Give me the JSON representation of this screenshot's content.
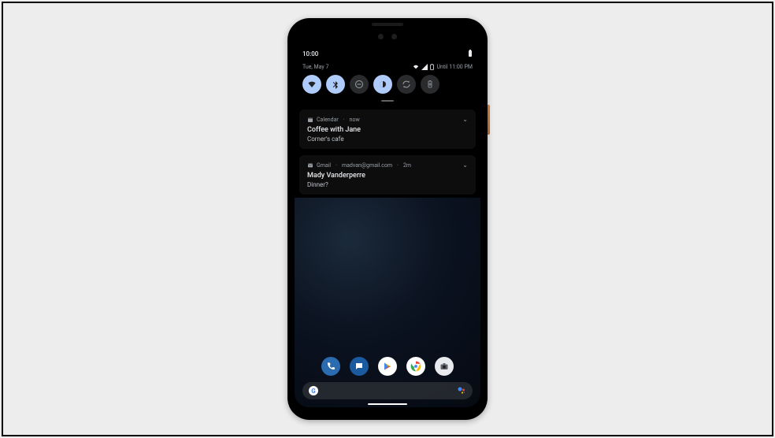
{
  "statusbar": {
    "time": "10:00"
  },
  "shade": {
    "date": "Tue, May 7",
    "alarm": "Until 11:00 PM"
  },
  "qs": [
    {
      "name": "wifi-icon",
      "on": true
    },
    {
      "name": "bluetooth-icon",
      "on": true
    },
    {
      "name": "dnd-icon",
      "on": false
    },
    {
      "name": "dark-theme-icon",
      "on": true
    },
    {
      "name": "rotate-icon",
      "on": false
    },
    {
      "name": "battery-saver-icon",
      "on": false
    }
  ],
  "notifications": [
    {
      "app": "Calendar",
      "time": "now",
      "title": "Coffee with Jane",
      "body": "Corner's cafe",
      "icon": "calendar-icon"
    },
    {
      "app": "Gmail",
      "account": "madvan@gmail.com",
      "time": "2m",
      "title": "Mady Vanderperre",
      "body": "Dinner?",
      "icon": "mail-icon"
    }
  ],
  "dock": [
    {
      "name": "phone-app-icon",
      "bg": "#2b6cb0",
      "glyph": "phone"
    },
    {
      "name": "messages-app-icon",
      "bg": "#1a5a9e",
      "glyph": "chat"
    },
    {
      "name": "play-store-icon",
      "bg": "#202124",
      "glyph": "play"
    },
    {
      "name": "chrome-app-icon",
      "bg": "#fff",
      "glyph": "chrome"
    },
    {
      "name": "camera-app-icon",
      "bg": "#3c4043",
      "glyph": "camera"
    }
  ],
  "search": {
    "logo": "G"
  }
}
